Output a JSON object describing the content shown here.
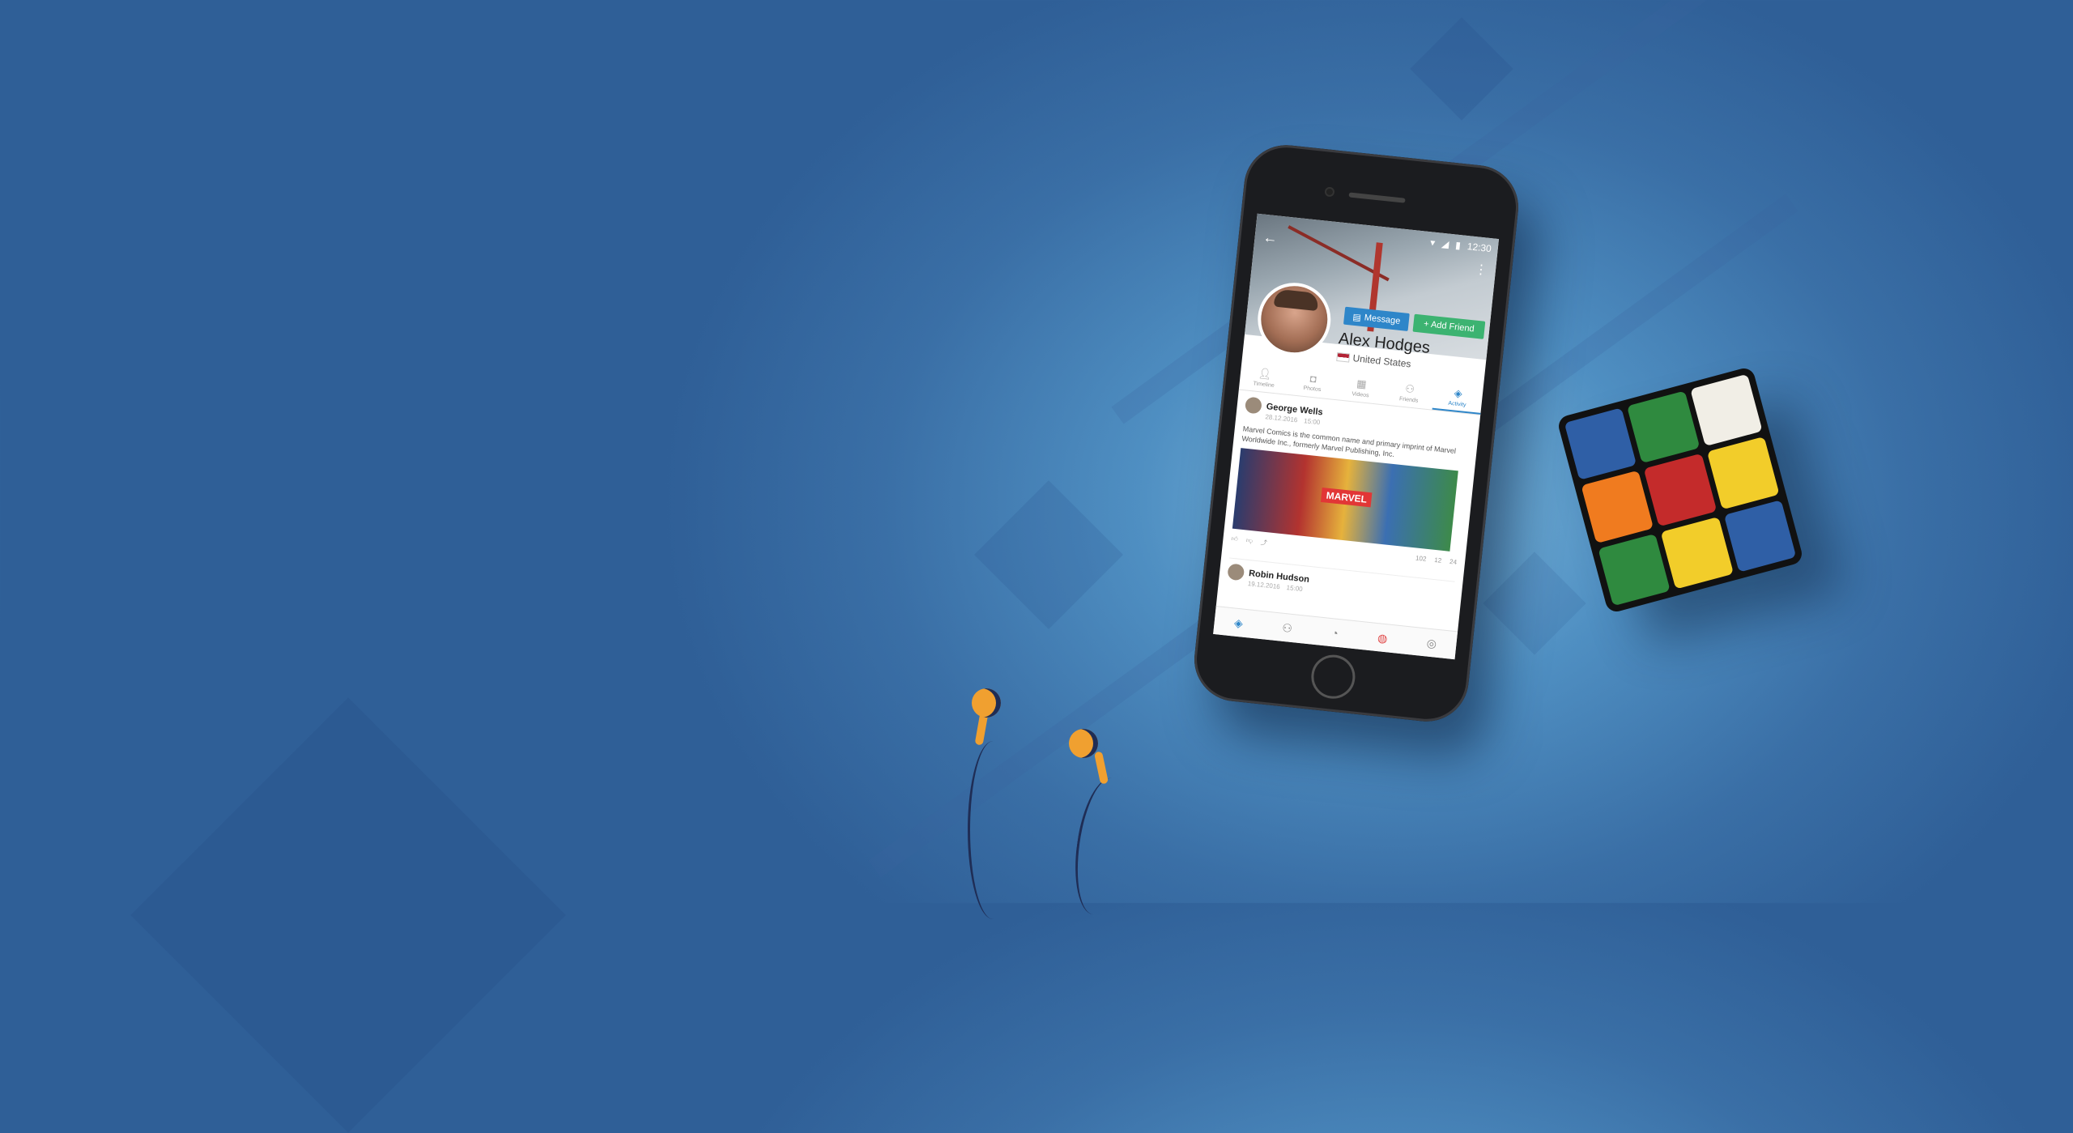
{
  "status_bar": {
    "time": "12:30"
  },
  "profile": {
    "name": "Alex Hodges",
    "country": "United States",
    "message_button": "Message",
    "add_friend_button": "+ Add Friend"
  },
  "tabs": [
    {
      "label": "Timeline",
      "icon": "user-icon"
    },
    {
      "label": "Photos",
      "icon": "camera-icon"
    },
    {
      "label": "Videos",
      "icon": "video-icon"
    },
    {
      "label": "Friends",
      "icon": "friends-icon"
    },
    {
      "label": "Activity",
      "icon": "cube-icon"
    }
  ],
  "post1": {
    "author": "George Wells",
    "date": "28.12.2016",
    "time": "15:00",
    "text": "Marvel Comics is the common name and primary imprint of Marvel Worldwide Inc., formerly Marvel Publishing, Inc.",
    "image_label": "MARVEL",
    "likes": "102",
    "dislikes": "12",
    "shares": "24"
  },
  "post2": {
    "author": "Robin Hudson",
    "date": "19.12.2016",
    "time": "15:00"
  },
  "bottom_nav": [
    "home-icon",
    "friends-icon",
    "chat-icon",
    "notification-icon",
    "more-icon"
  ],
  "colors": {
    "accent": "#2e86c9",
    "add_friend": "#3cb371",
    "cube": [
      "#2f5fa6",
      "#2f8a3f",
      "#f1eee6",
      "#f07b1f",
      "#c42b2b",
      "#f2cd2a",
      "#2f8a3f",
      "#f2cd2a",
      "#2f5fa6"
    ]
  }
}
